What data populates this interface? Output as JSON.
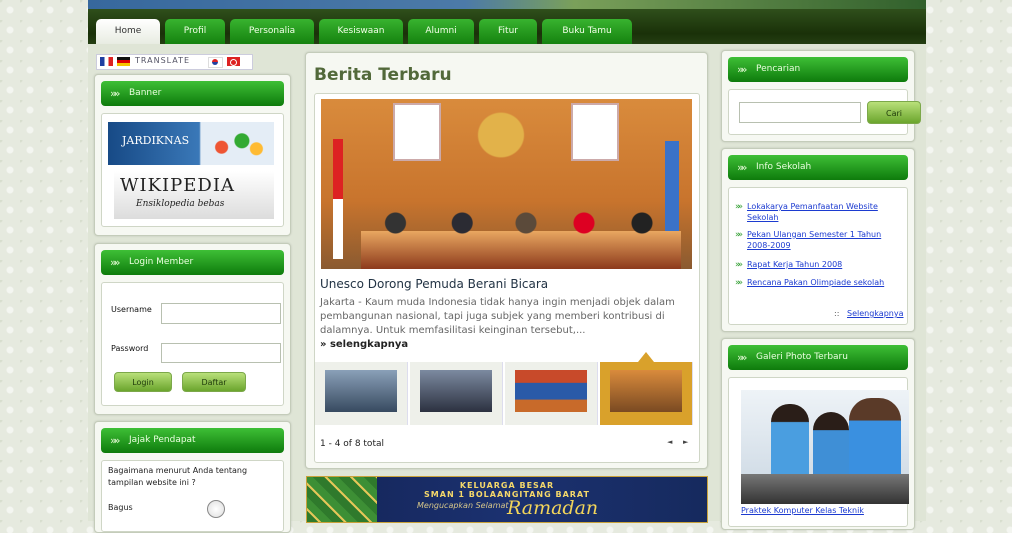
{
  "nav": {
    "tabs": [
      "Home",
      "Profil",
      "Personalia",
      "Kesiswaan",
      "Alumni",
      "Fitur",
      "Buku Tamu"
    ]
  },
  "translate": {
    "label": "TRANSLATE"
  },
  "banner": {
    "title": "Banner",
    "jardiknas": "JARDIKNAS",
    "wiki_title": "WIKIPEDIA",
    "wiki_sub": "Ensiklopedia bebas"
  },
  "login": {
    "title": "Login Member",
    "username_label": "Username",
    "password_label": "Password",
    "login_button": "Login",
    "register_button": "Daftar"
  },
  "poll": {
    "title": "Jajak Pendapat",
    "question": "Bagaimana menurut Anda tentang tampilan website ini ?",
    "option1": "Bagus"
  },
  "news": {
    "section_title": "Berita Terbaru",
    "headline": "Unesco Dorong Pemuda Berani Bicara",
    "summary": "Jakarta - Kaum muda Indonesia tidak hanya ingin menjadi objek dalam pembangunan nasional, tapi juga subjek yang memberi kontribusi di dalamnya. Untuk memfasilitasi keinginan tersebut,...",
    "read_more": "» selengkapnya",
    "pagination": "1 - 4 of 8 total",
    "prev": "◄",
    "next": "►"
  },
  "ramadan": {
    "line1": "KELUARGA BESAR",
    "line2": "SMAN 1 BOLAANGITANG BARAT",
    "line3": "Mengucapkan Selamat",
    "line4": "Ramadan"
  },
  "search": {
    "title": "Pencarian",
    "button": "Cari",
    "placeholder": ""
  },
  "info": {
    "title": "Info Sekolah",
    "items": [
      "Lokakarya Pemanfaatan Website Sekolah",
      "Pekan Ulangan Semester 1 Tahun 2008-2009",
      "Rapat Kerja Tahun 2008",
      "Rencana Pakan Olimpiade sekolah"
    ],
    "more_prefix": "::",
    "more": "Selengkapnya"
  },
  "gallery": {
    "title": "Galeri Photo Terbaru",
    "caption": "Praktek Komputer Kelas Teknik"
  },
  "colors": {
    "accent_green": "#15820f",
    "title_green": "#52693a",
    "link_blue": "#1c3bd0",
    "thumb_active": "#d9a12b"
  }
}
